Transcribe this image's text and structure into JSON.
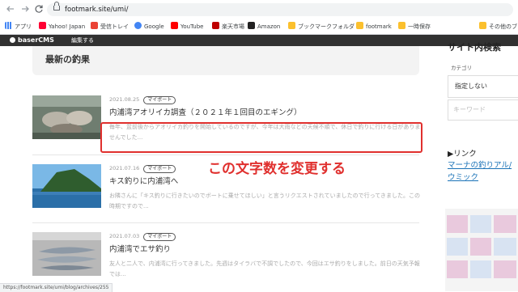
{
  "browser": {
    "url": "footmark.site/umi/",
    "back_icon": "arrow-left-icon",
    "forward_icon": "arrow-right-icon",
    "reload_icon": "reload-icon",
    "bookmarks": [
      "アプリ",
      "Yahoo! Japan",
      "受信トレイ",
      "Google",
      "YouTube",
      "楽天市場",
      "Amazon",
      "ブックマークフォルダ",
      "footmark",
      "一時保存",
      "その他のブ"
    ]
  },
  "adminbar": {
    "logo": "baserCMS",
    "edit_label": "編集する"
  },
  "main": {
    "section_title": "最新の釣果",
    "posts": [
      {
        "date": "2021.08.25",
        "tag": "マイポート",
        "title": "内浦湾アオリイカ調査（２０２１年１回目のエギング）",
        "excerpt": "毎年、盆前後からアオリイカ釣りを開始しているのですが、今年は大雨などの天候不順で、休日で釣りに行ける日がありませんでした..."
      },
      {
        "date": "2021.07.16",
        "tag": "マイポート",
        "title": "キス釣りに内浦湾へ",
        "excerpt": "お隣さんに「キス釣りに行きたいのでボートに乗せてほしい」と言うリクエストされていましたので行ってきました。この時期ですので..."
      },
      {
        "date": "2021.07.03",
        "tag": "マイポート",
        "title": "内浦湾でエサ釣り",
        "excerpt": "友人と二人で、内浦湾に行ってきました。先週はタイラバで不調でしたので、今回はエサ釣りをしました。前日の天気予報では..."
      }
    ]
  },
  "annotation": {
    "text": "この文字数を変更する",
    "color": "#e0302e"
  },
  "sidebar": {
    "title": "サイト内検索",
    "category_label": "カテゴリ",
    "category_selected": "指定しない",
    "keyword_placeholder": "キーワード",
    "links_heading": "▶リンク",
    "links": [
      "マーナの釣りアル/",
      "ウミック"
    ]
  },
  "status_url": "https://footmark.site/umi/blog/archives/255"
}
